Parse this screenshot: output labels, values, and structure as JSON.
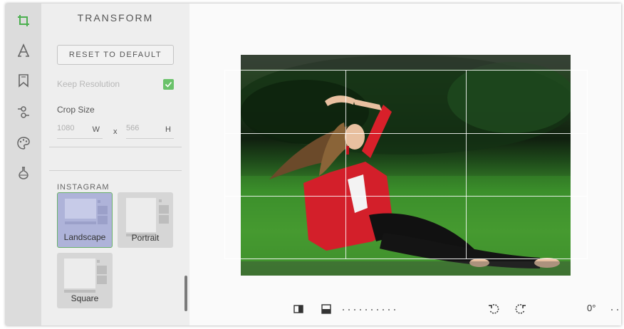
{
  "rail": {
    "items": [
      {
        "icon": "crop-icon",
        "active": true
      },
      {
        "icon": "text-icon"
      },
      {
        "icon": "bookmark-icon"
      },
      {
        "icon": "adjust-icon"
      },
      {
        "icon": "palette-icon"
      },
      {
        "icon": "flask-icon"
      }
    ],
    "active_color": "#4caf50"
  },
  "panel": {
    "title": "TRANSFORM",
    "reset_label": "RESET TO DEFAULT",
    "keep_resolution_label": "Keep Resolution",
    "keep_resolution_checked": true,
    "crop_size_label": "Crop Size",
    "width_value": "1080",
    "width_unit": "W",
    "x_label": "x",
    "height_value": "566",
    "height_unit": "H",
    "section": "INSTAGRAM",
    "presets": [
      {
        "label": "Landscape",
        "selected": true
      },
      {
        "label": "Portrait",
        "selected": false
      },
      {
        "label": "Square",
        "selected": false
      }
    ]
  },
  "toolbar": {
    "angle": "0°",
    "icons": [
      "flip-horizontal-icon",
      "flip-vertical-icon",
      "rotate-left-icon",
      "rotate-right-icon"
    ]
  },
  "colors": {
    "check": "#6ac26a",
    "selected_preset": "#aeb3d9"
  }
}
